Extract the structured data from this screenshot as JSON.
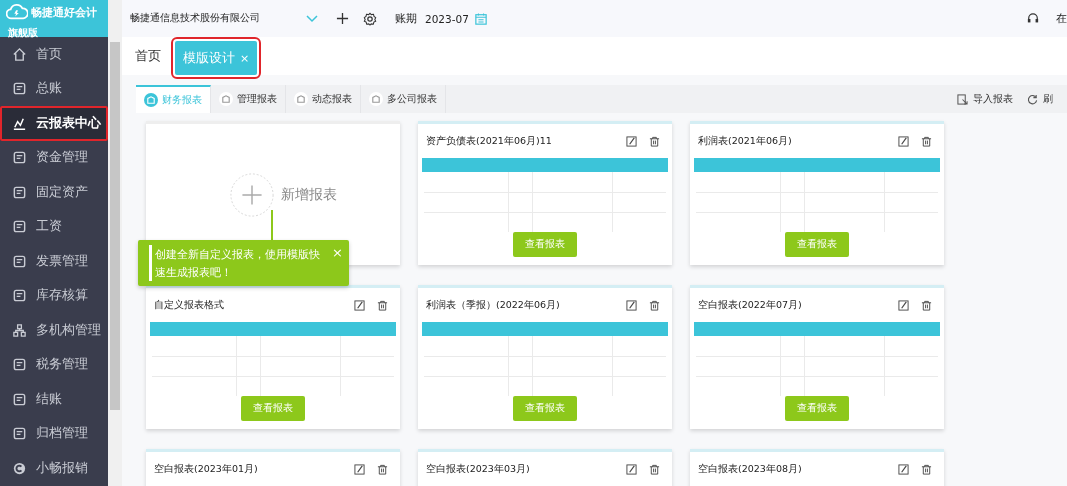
{
  "app": {
    "logo": "畅捷通好会计",
    "edition": "旗舰版"
  },
  "sidebar": {
    "items": [
      {
        "label": "首页",
        "selected": false,
        "highlighted": false
      },
      {
        "label": "总账",
        "selected": false,
        "highlighted": false
      },
      {
        "label": "云报表中心",
        "selected": true,
        "highlighted": true
      },
      {
        "label": "资金管理",
        "selected": false,
        "highlighted": false
      },
      {
        "label": "固定资产",
        "selected": false,
        "highlighted": false
      },
      {
        "label": "工资",
        "selected": false,
        "highlighted": false
      },
      {
        "label": "发票管理",
        "selected": false,
        "highlighted": false
      },
      {
        "label": "库存核算",
        "selected": false,
        "highlighted": false
      },
      {
        "label": "多机构管理",
        "selected": false,
        "highlighted": false
      },
      {
        "label": "税务管理",
        "selected": false,
        "highlighted": false
      },
      {
        "label": "结账",
        "selected": false,
        "highlighted": false
      },
      {
        "label": "归档管理",
        "selected": false,
        "highlighted": false
      },
      {
        "label": "小畅报销",
        "selected": false,
        "highlighted": false
      }
    ]
  },
  "topbar": {
    "company": "畅捷通信息技术股份有限公司",
    "period_label": "账期",
    "period": "2023-07",
    "service": "在"
  },
  "tabs": [
    {
      "label": "首页",
      "selected": false,
      "highlighted": false
    },
    {
      "label": "模版设计",
      "selected": true,
      "highlighted": true,
      "close": "×"
    }
  ],
  "subtabs": [
    {
      "label": "财务报表",
      "selected": true
    },
    {
      "label": "管理报表",
      "selected": false
    },
    {
      "label": "动态报表",
      "selected": false
    },
    {
      "label": "多公司报表",
      "selected": false
    }
  ],
  "actions": [
    {
      "label": "导入报表",
      "kind": "import"
    },
    {
      "label": "刷",
      "kind": "refresh"
    }
  ],
  "new_card": {
    "label": "新增报表"
  },
  "tooltip": {
    "text": "创建全新自定义报表，使用模版快速生成报表吧！",
    "close": "×"
  },
  "cards": [
    {
      "title": "资产负债表(2021年06月)11",
      "button": "查看报表"
    },
    {
      "title": "利润表(2021年06月)",
      "button": "查看报表"
    },
    {
      "title": "自定义报表格式",
      "button": "查看报表"
    },
    {
      "title": "利润表（季报）(2022年06月)",
      "button": "查看报表"
    },
    {
      "title": "空白报表(2022年07月)",
      "button": "查看报表"
    },
    {
      "title": "空白报表(2023年01月)"
    },
    {
      "title": "空白报表(2023年03月)"
    },
    {
      "title": "空白报表(2023年08月)"
    }
  ]
}
